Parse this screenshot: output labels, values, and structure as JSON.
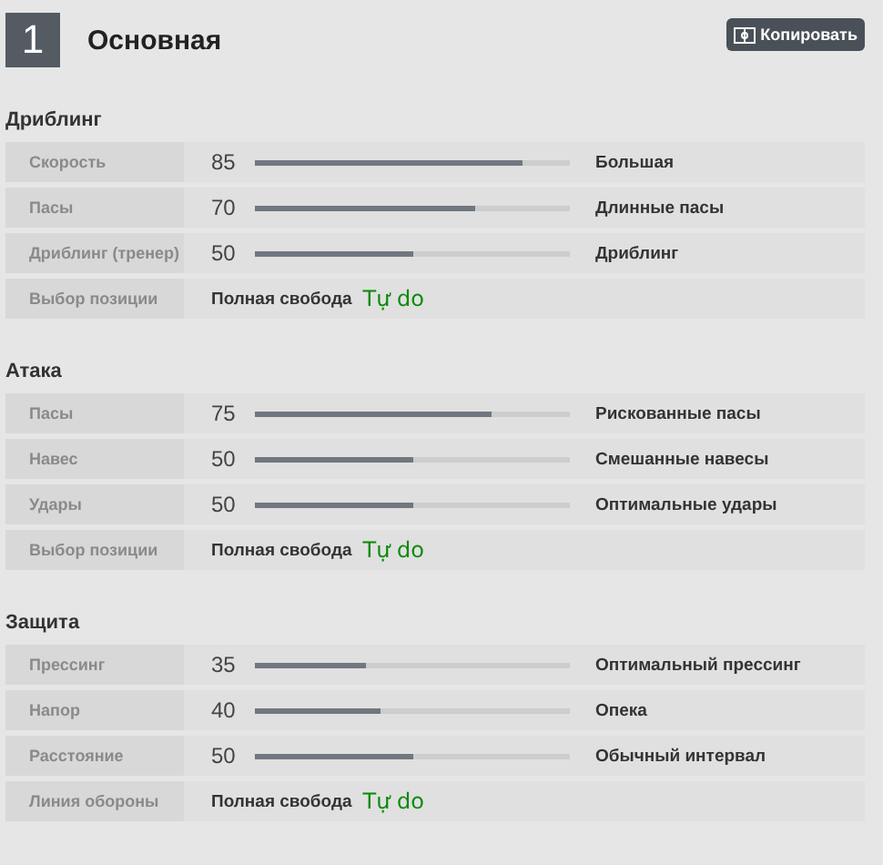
{
  "header": {
    "number": "1",
    "title": "Основная",
    "copy_button": "Копировать"
  },
  "sections": [
    {
      "title": "Дриблинг",
      "rows": [
        {
          "kind": "slider",
          "label": "Скорость",
          "value": "85",
          "level": 0.85,
          "setting": "Большая"
        },
        {
          "kind": "slider",
          "label": "Пасы",
          "value": "70",
          "level": 0.7,
          "setting": "Длинные пасы"
        },
        {
          "kind": "slider",
          "label": "Дриблинг (тренер)",
          "value": "50",
          "level": 0.5,
          "setting": "Дриблинг"
        },
        {
          "kind": "choice",
          "label": "Выбор позиции",
          "setting": "Полная свобода",
          "note": "Tự do"
        }
      ]
    },
    {
      "title": "Атака",
      "rows": [
        {
          "kind": "slider",
          "label": "Пасы",
          "value": "75",
          "level": 0.75,
          "setting": "Рискованные пасы"
        },
        {
          "kind": "slider",
          "label": "Навес",
          "value": "50",
          "level": 0.5,
          "setting": "Смешанные навесы"
        },
        {
          "kind": "slider",
          "label": "Удары",
          "value": "50",
          "level": 0.5,
          "setting": "Оптимальные удары"
        },
        {
          "kind": "choice",
          "label": "Выбор позиции",
          "setting": "Полная свобода",
          "note": "Tự do"
        }
      ]
    },
    {
      "title": "Защита",
      "rows": [
        {
          "kind": "slider",
          "label": "Прессинг",
          "value": "35",
          "level": 0.35,
          "setting": "Оптимальный прессинг"
        },
        {
          "kind": "slider",
          "label": "Напор",
          "value": "40",
          "level": 0.4,
          "setting": "Опека"
        },
        {
          "kind": "slider",
          "label": "Расстояние",
          "value": "50",
          "level": 0.5,
          "setting": "Обычный интервал"
        },
        {
          "kind": "choice",
          "label": "Линия обороны",
          "setting": "Полная свобода",
          "note": "Tự do"
        }
      ]
    }
  ]
}
